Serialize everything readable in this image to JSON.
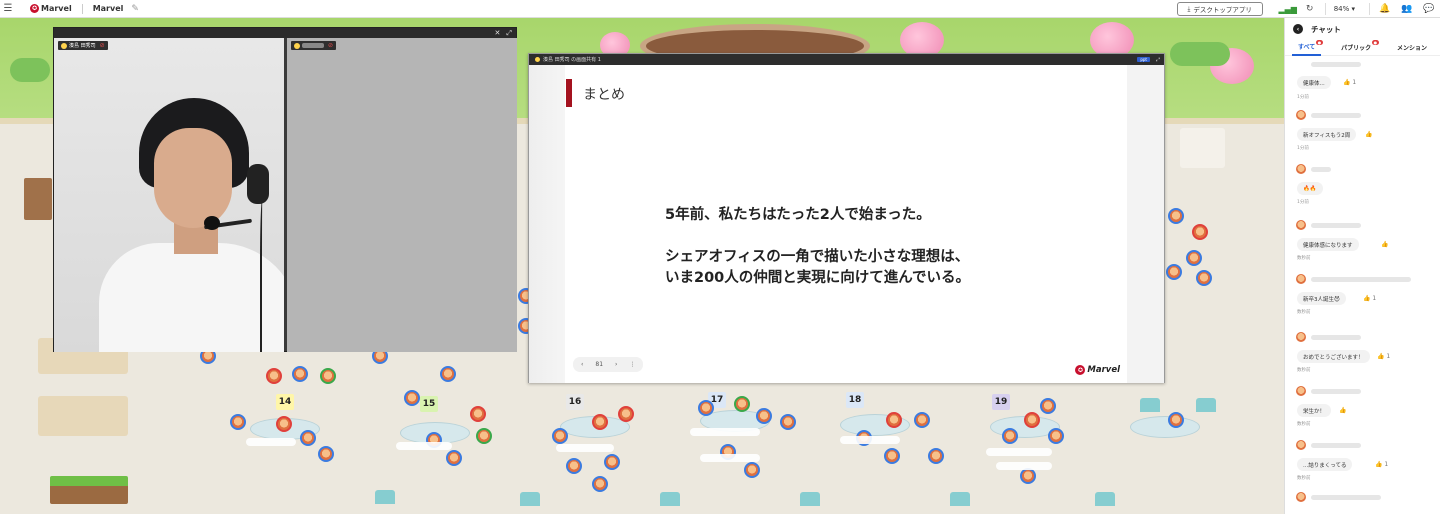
{
  "topbar": {
    "brand": "Marvel",
    "space_name": "Marvel",
    "desktop_app_label": "デスクトップアプリ",
    "zoom": "84%"
  },
  "video": {
    "speaker_label": "湊島 田秀司"
  },
  "slide": {
    "window_title": "湊島 田秀司 の画面共有 1",
    "tag": "ppt",
    "heading": "まとめ",
    "body": "5年前、私たちはたった2人で始まった。\n\nシェアオフィスの一角で描いた小さな理想は、\nいま200人の仲間と実現に向けて進んでいる。",
    "page": "81",
    "logo_text": "Marvel"
  },
  "tables": [
    "14",
    "15",
    "16",
    "17",
    "18",
    "19"
  ],
  "chat": {
    "title": "チャット",
    "tabs": [
      {
        "label": "すべて",
        "badge": "●"
      },
      {
        "label": "パブリック",
        "badge": "●"
      },
      {
        "label": "メンション",
        "badge": ""
      }
    ],
    "messages": [
      {
        "text": "健康体...",
        "react": "👍 1",
        "time": "1分前"
      },
      {
        "text": "新オフィスもう2周",
        "react": "👍",
        "time": "1分前"
      },
      {
        "text": "🔥🔥",
        "react": "",
        "time": "1分前"
      },
      {
        "text": "健康体感になります",
        "react": "👍",
        "time": "数秒前"
      },
      {
        "text": "新卒3人誕生😈",
        "react": "👍 1",
        "time": "数秒前"
      },
      {
        "text": "おめでとうございます！",
        "react": "👍 1",
        "time": "数秒前"
      },
      {
        "text": "栄生か！",
        "react": "👍",
        "time": "数秒前"
      },
      {
        "text": "...詰りまくってる",
        "react": "👍 1",
        "time": "数秒前"
      }
    ]
  },
  "colors": {
    "brand_red": "#c8102e",
    "accent_blue": "#2260d6"
  }
}
